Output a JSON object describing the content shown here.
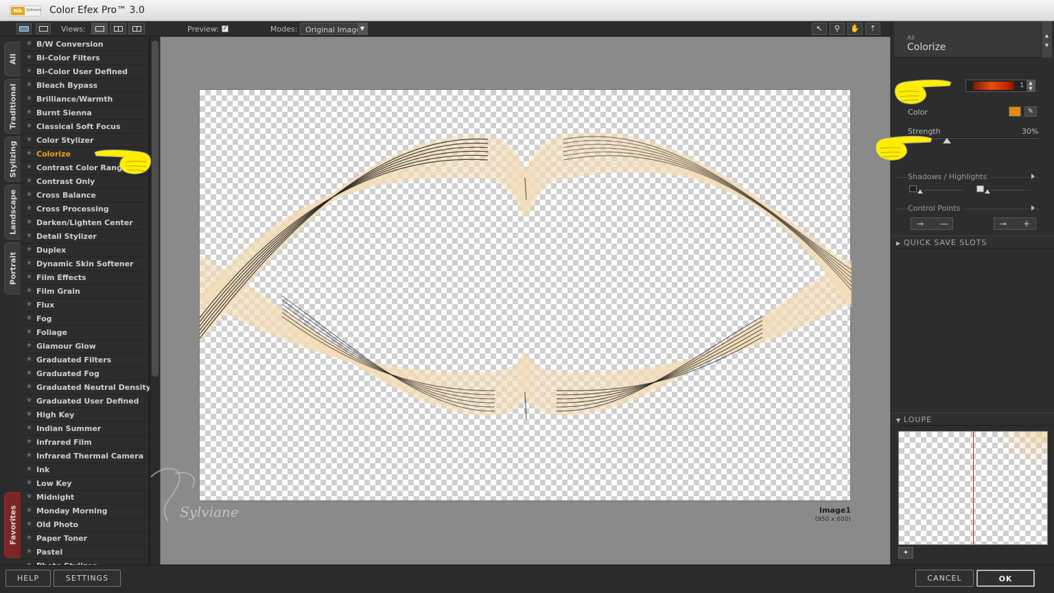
{
  "window": {
    "title": "Color Efex Pro™ 3.0",
    "logo_text": "Nik",
    "logo_sub": "Software"
  },
  "toolbar": {
    "views_label": "Views:",
    "preview_label": "Preview:",
    "preview_checked": true,
    "modes_label": "Modes:",
    "modes_value": "Original Image",
    "tools": [
      "pointer-tool-icon",
      "zoom-tool-icon",
      "hand-tool-icon",
      "loupe-tool-icon"
    ]
  },
  "left_tabs": [
    "All",
    "Traditional",
    "Stylizing",
    "Landscape",
    "Portrait",
    "Favorites"
  ],
  "filters": {
    "selected": "Colorize",
    "items": [
      "B/W Conversion",
      "Bi-Color Filters",
      "Bi-Color User Defined",
      "Bleach Bypass",
      "Brilliance/Warmth",
      "Burnt Sienna",
      "Classical Soft Focus",
      "Color Stylizer",
      "Colorize",
      "Contrast Color Range",
      "Contrast Only",
      "Cross Balance",
      "Cross Processing",
      "Darken/Lighten Center",
      "Detail Stylizer",
      "Duplex",
      "Dynamic Skin Softener",
      "Film Effects",
      "Film Grain",
      "Flux",
      "Fog",
      "Foliage",
      "Glamour Glow",
      "Graduated Filters",
      "Graduated Fog",
      "Graduated Neutral Density",
      "Graduated User Defined",
      "High Key",
      "Indian Summer",
      "Infrared Film",
      "Infrared Thermal Camera",
      "Ink",
      "Low Key",
      "Midnight",
      "Monday Morning",
      "Old Photo",
      "Paper Toner",
      "Pastel",
      "Photo Stylizer"
    ]
  },
  "preview": {
    "image_name": "Image1",
    "image_size": "(950 x 600)",
    "watermark": "Sylviane"
  },
  "filter_panel": {
    "category": "All",
    "filter_name": "Colorize",
    "method_value": "1",
    "color_label": "Color",
    "color_hex": "#e08a10",
    "strength_label": "Strength",
    "strength_value": "30%",
    "strength_fraction": 0.3,
    "shadows_highlights_label": "Shadows / Highlights",
    "control_points_label": "Control Points",
    "quick_save_label": "QUICK SAVE SLOTS",
    "loupe_label": "LOUPE"
  },
  "bottom": {
    "help": "HELP",
    "settings": "SETTINGS",
    "cancel": "CANCEL",
    "ok": "OK"
  },
  "colors": {
    "accent": "#f0a020",
    "hand": "#ffee00",
    "ribbon": "#f3dcb8"
  }
}
